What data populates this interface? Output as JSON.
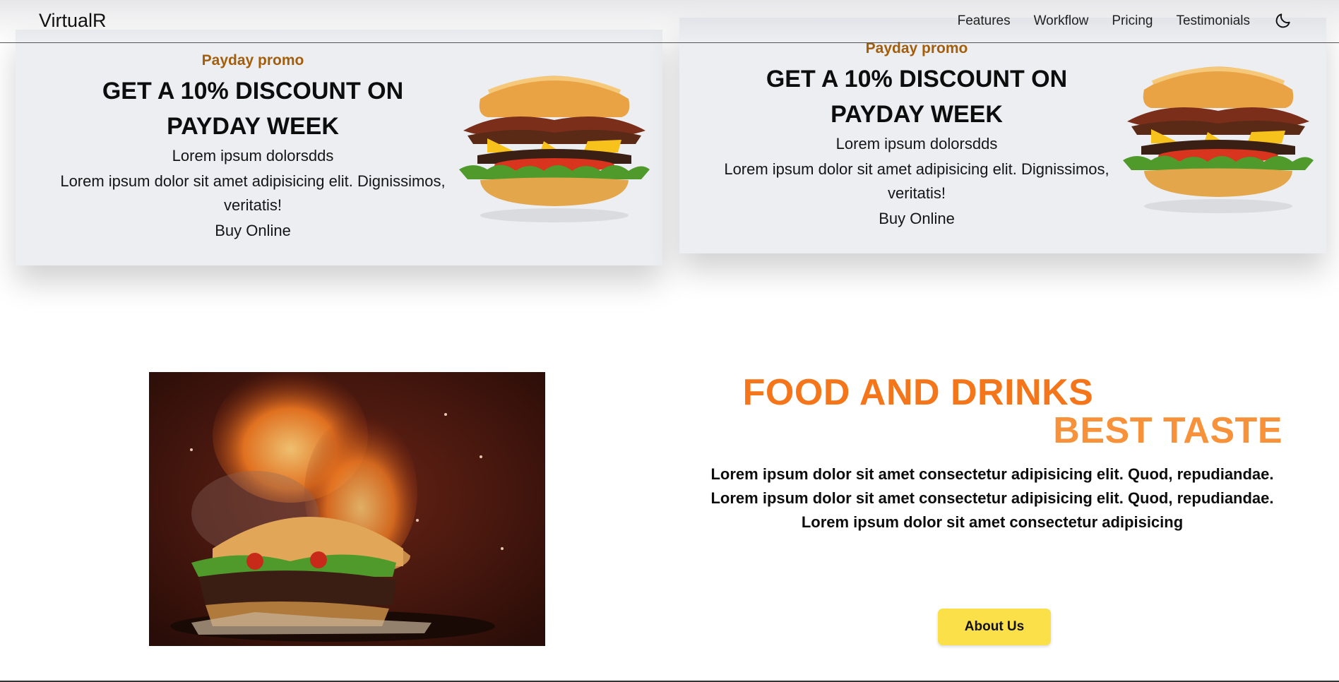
{
  "navbar": {
    "brand": "VirtualR",
    "links": [
      "Features",
      "Workflow",
      "Pricing",
      "Testimonials"
    ],
    "theme_icon": "moon-icon"
  },
  "promos": [
    {
      "tag": "Payday promo",
      "title_line1": "GET A 10% DISCOUNT ON",
      "title_line2": "PAYDAY WEEK",
      "subtitle": "Lorem ipsum dolorsdds",
      "description": "Lorem ipsum dolor sit amet adipisicing elit. Dignissimos, veritatis!",
      "cta": "Buy Online"
    },
    {
      "tag": "Payday promo",
      "title_line1": "GET A 10% DISCOUNT ON",
      "title_line2": "PAYDAY WEEK",
      "subtitle": "Lorem ipsum dolorsdds",
      "description": "Lorem ipsum dolor sit amet adipisicing elit. Dignissimos, veritatis!",
      "cta": "Buy Online"
    }
  ],
  "about": {
    "title": "FOOD AND DRINKS",
    "subtitle": "BEST TASTE",
    "text_line1": "Lorem ipsum dolor sit amet consectetur adipisicing elit. Quod, repudiandae.",
    "text_line2": "Lorem ipsum dolor sit amet consectetur adipisicing elit. Quod, repudiandae.",
    "text_line3": "Lorem ipsum dolor sit amet consectetur adipisicing",
    "button": "About Us"
  },
  "colors": {
    "promo_tag": "#a35e0b",
    "accent_orange": "#f5761a",
    "button_yellow": "#fbe04a",
    "card_bg": "#eceef2"
  }
}
